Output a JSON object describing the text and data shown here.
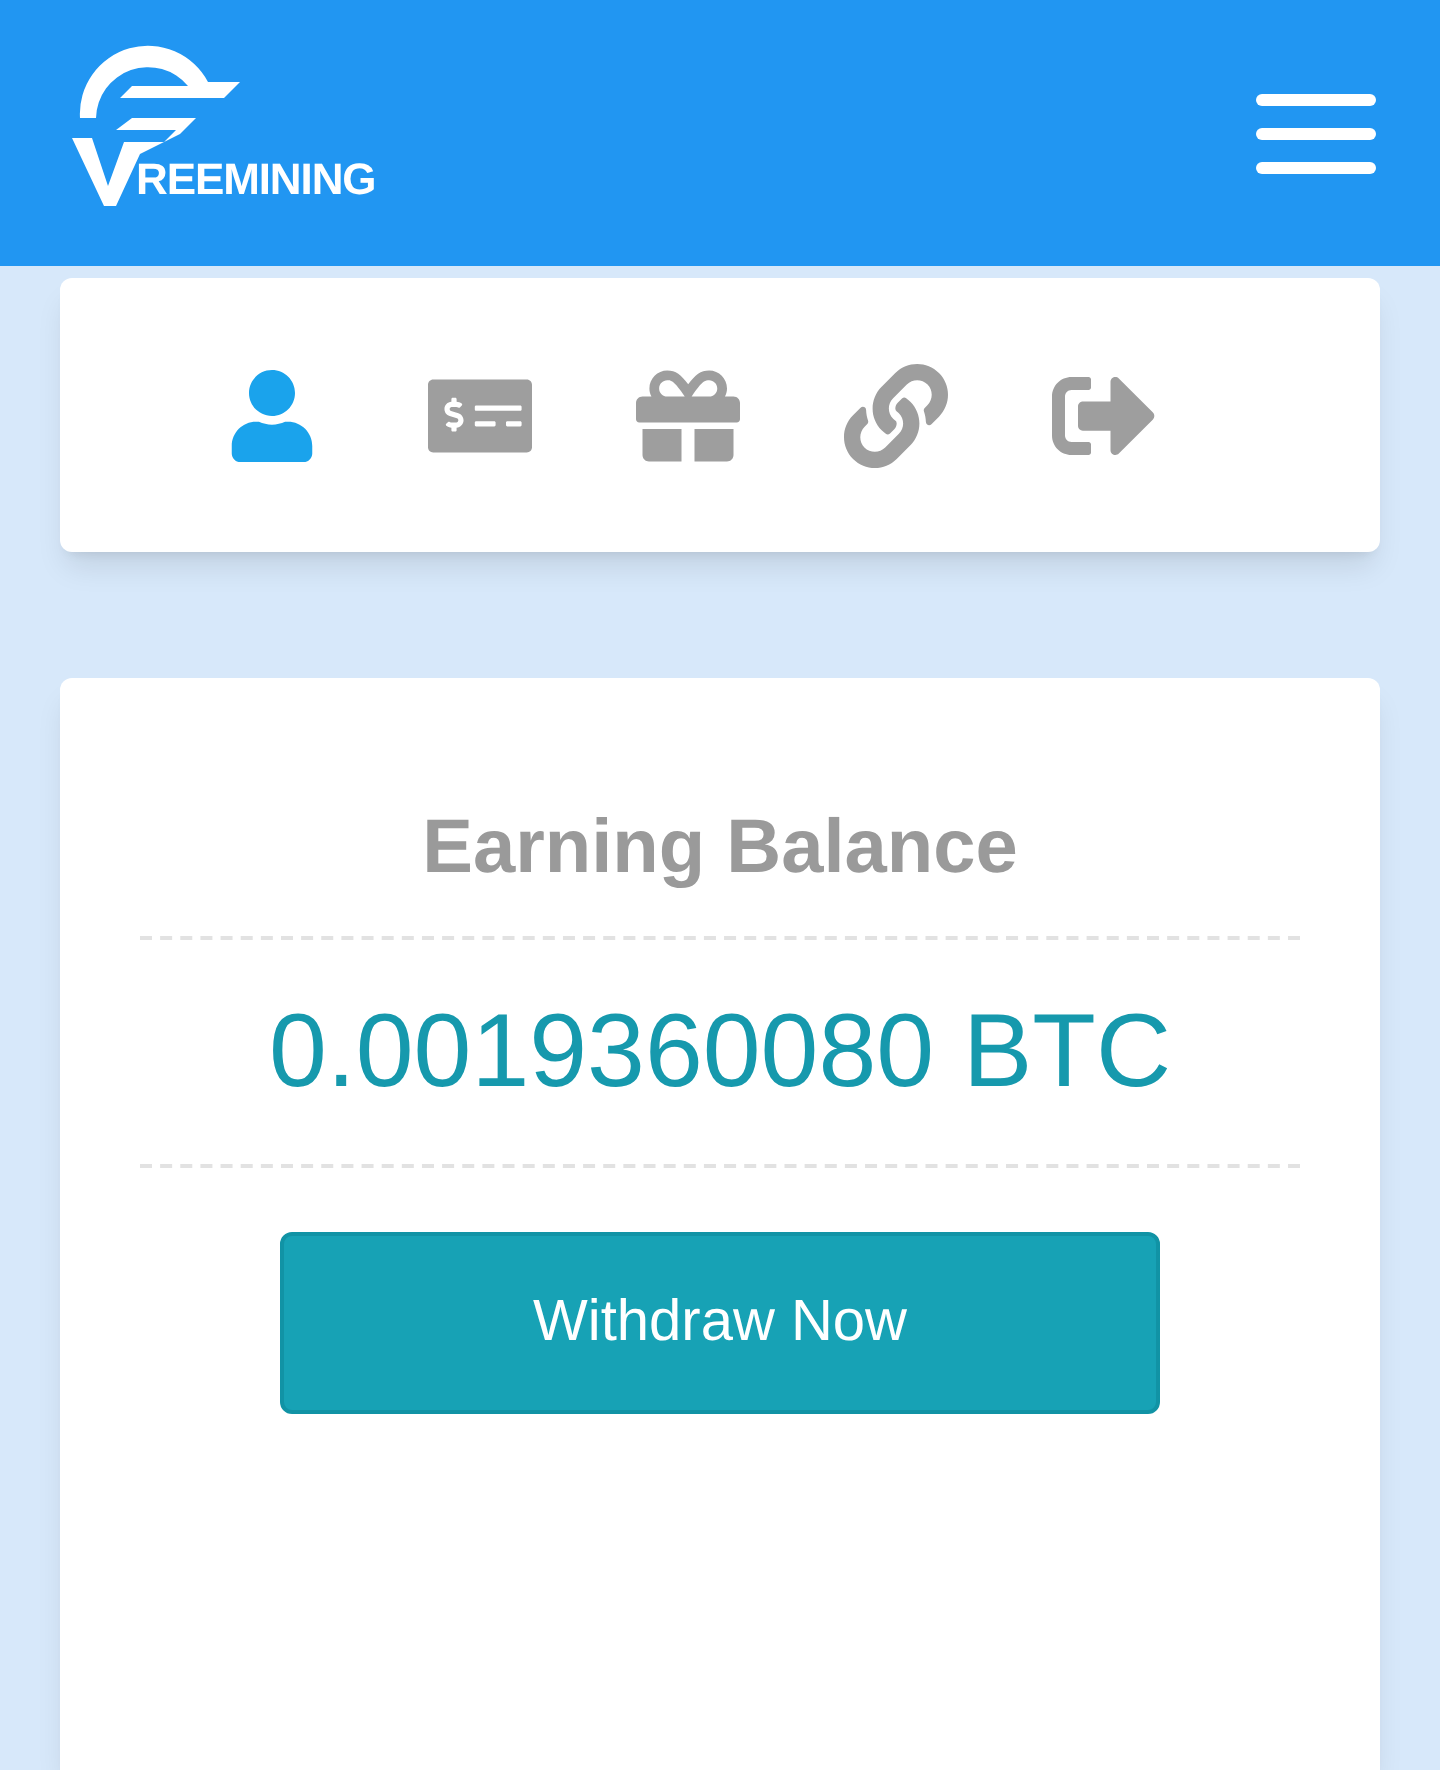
{
  "header": {
    "logo_text": "REEMINING"
  },
  "nav": [
    {
      "kind": "profile",
      "selected": true
    },
    {
      "kind": "payment",
      "selected": false
    },
    {
      "kind": "gift",
      "selected": false
    },
    {
      "kind": "link",
      "selected": false
    },
    {
      "kind": "logout",
      "selected": false
    }
  ],
  "balance_card": {
    "title": "Earning Balance",
    "amount": "0.0019360080 BTC",
    "button": "Withdraw Now"
  }
}
